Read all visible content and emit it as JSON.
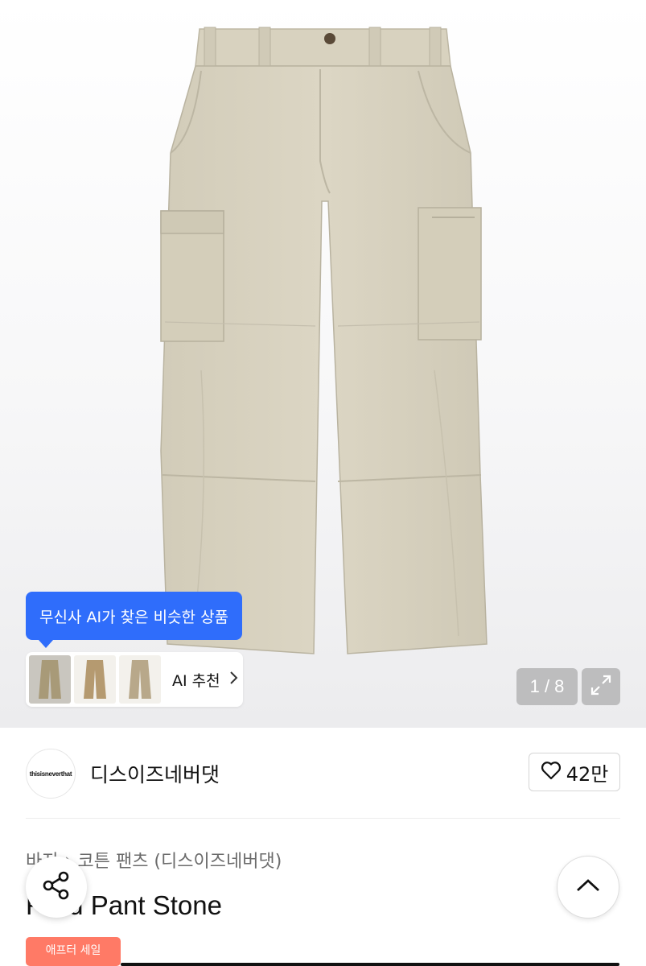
{
  "gallery": {
    "image_alt": "Field Pant Stone",
    "current_page": "1",
    "page_total": "8",
    "counter_text": "1 / 8"
  },
  "ai_recommend": {
    "tooltip": "무신사 AI가 찾은 비슷한 상품",
    "label": "AI 추천",
    "thumbnail_count": 3
  },
  "brand": {
    "logo_text": "thisisneverthat",
    "name": "디스이즈네버댓",
    "likes": "42만"
  },
  "breadcrumb": {
    "category": "바지",
    "subcategory": "코튼 팬츠 (디스이즈네버댓)"
  },
  "product": {
    "title_visible": "Field Pant Stone",
    "discount_badge": "애프터 세일"
  },
  "icons": {
    "heart": "heart-icon",
    "share": "share-icon",
    "expand": "expand-icon",
    "scroll_top": "chevron-up-icon",
    "ai_arrow": "chevron-right-icon"
  },
  "colors": {
    "accent_blue": "#2f6dfb",
    "badge_coral": "#ff7a66",
    "pants_khaki": "#d6d0bd"
  }
}
